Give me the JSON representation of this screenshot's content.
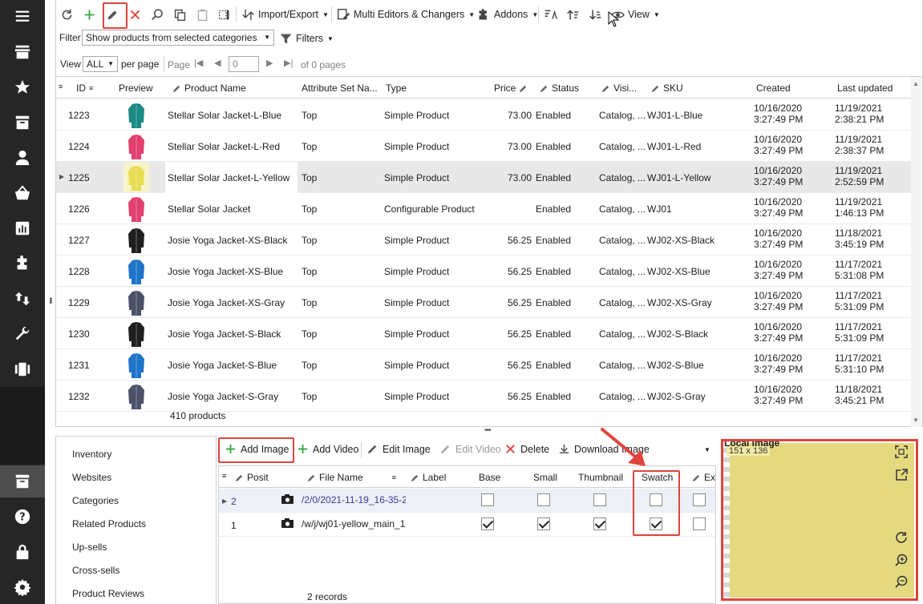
{
  "toolbar": {
    "import_export": "Import/Export",
    "multi_editors": "Multi Editors & Changers",
    "addons": "Addons",
    "view": "View"
  },
  "filter": {
    "label": "Filter",
    "value": "Show products from selected categories",
    "filters_button": "Filters"
  },
  "pager": {
    "view_label": "View",
    "view_value": "ALL",
    "per_page": "per page",
    "page_label": "Page",
    "page_value": "0",
    "of_pages": "of 0 pages"
  },
  "grid": {
    "columns": [
      "ID",
      "Preview",
      "Product Name",
      "Attribute Set Na...",
      "Type",
      "Price",
      "Status",
      "Visi...",
      "SKU",
      "Created",
      "Last updated"
    ],
    "rows": [
      {
        "id": "1223",
        "name": "Stellar Solar Jacket-L-Blue",
        "attr": "Top",
        "type": "Simple Product",
        "price": "73.00",
        "status": "Enabled",
        "vis": "Catalog, ...",
        "sku": "WJ01-L-Blue",
        "created": "10/16/2020 3:27:49 PM",
        "updated": "11/19/2021 2:38:21 PM",
        "color": "teal"
      },
      {
        "id": "1224",
        "name": "Stellar Solar Jacket-L-Red",
        "attr": "Top",
        "type": "Simple Product",
        "price": "73.00",
        "status": "Enabled",
        "vis": "Catalog, ...",
        "sku": "WJ01-L-Red",
        "created": "10/16/2020 3:27:49 PM",
        "updated": "11/19/2021 2:38:37 PM",
        "color": "pink"
      },
      {
        "id": "1225",
        "name": "Stellar Solar Jacket-L-Yellow",
        "attr": "Top",
        "type": "Simple Product",
        "price": "73.00",
        "status": "Enabled",
        "vis": "Catalog, ...",
        "sku": "WJ01-L-Yellow",
        "created": "10/16/2020 3:27:49 PM",
        "updated": "11/19/2021 2:52:59 PM",
        "color": "yellow"
      },
      {
        "id": "1226",
        "name": "Stellar Solar Jacket",
        "attr": "Top",
        "type": "Configurable Product",
        "price": "",
        "status": "Enabled",
        "vis": "Catalog, ...",
        "sku": "WJ01",
        "created": "10/16/2020 3:27:49 PM",
        "updated": "11/19/2021 1:46:13 PM",
        "color": "pink"
      },
      {
        "id": "1227",
        "name": "Josie Yoga Jacket-XS-Black",
        "attr": "Top",
        "type": "Simple Product",
        "price": "56.25",
        "status": "Enabled",
        "vis": "Catalog, ...",
        "sku": "WJ02-XS-Black",
        "created": "10/16/2020 3:27:49 PM",
        "updated": "11/18/2021 3:45:19 PM",
        "color": "black"
      },
      {
        "id": "1228",
        "name": "Josie Yoga Jacket-XS-Blue",
        "attr": "Top",
        "type": "Simple Product",
        "price": "56.25",
        "status": "Enabled",
        "vis": "Catalog, ...",
        "sku": "WJ02-XS-Blue",
        "created": "10/16/2020 3:27:49 PM",
        "updated": "11/17/2021 5:31:08 PM",
        "color": "blue"
      },
      {
        "id": "1229",
        "name": "Josie Yoga Jacket-XS-Gray",
        "attr": "Top",
        "type": "Simple Product",
        "price": "56.25",
        "status": "Enabled",
        "vis": "Catalog, ...",
        "sku": "WJ02-XS-Gray",
        "created": "10/16/2020 3:27:49 PM",
        "updated": "11/17/2021 5:31:09 PM",
        "color": "gray"
      },
      {
        "id": "1230",
        "name": "Josie Yoga Jacket-S-Black",
        "attr": "Top",
        "type": "Simple Product",
        "price": "56.25",
        "status": "Enabled",
        "vis": "Catalog, ...",
        "sku": "WJ02-S-Black",
        "created": "10/16/2020 3:27:49 PM",
        "updated": "11/17/2021 5:31:09 PM",
        "color": "black"
      },
      {
        "id": "1231",
        "name": "Josie Yoga Jacket-S-Blue",
        "attr": "Top",
        "type": "Simple Product",
        "price": "56.25",
        "status": "Enabled",
        "vis": "Catalog, ...",
        "sku": "WJ02-S-Blue",
        "created": "10/16/2020 3:27:49 PM",
        "updated": "11/17/2021 5:31:10 PM",
        "color": "blue"
      },
      {
        "id": "1232",
        "name": "Josie Yoga Jacket-S-Gray",
        "attr": "Top",
        "type": "Simple Product",
        "price": "56.25",
        "status": "Enabled",
        "vis": "Catalog, ...",
        "sku": "WJ02-S-Gray",
        "created": "10/16/2020 3:27:49 PM",
        "updated": "11/18/2021 3:45:21 PM",
        "color": "gray"
      }
    ],
    "footer": "410 products"
  },
  "tabs": [
    "Inventory",
    "Websites",
    "Categories",
    "Related Products",
    "Up-sells",
    "Cross-sells",
    "Product Reviews"
  ],
  "images": {
    "add_image": "Add Image",
    "add_video": "Add Video",
    "edit_image": "Edit Image",
    "edit_video": "Edit Video",
    "delete": "Delete",
    "download": "Download Image",
    "columns": [
      "Posit",
      "File Name",
      "Label",
      "Base",
      "Small",
      "Thumbnail",
      "Swatch",
      "Ex"
    ],
    "rows": [
      {
        "pos": "2",
        "file": "/2/0/2021-11-19_16-35-2",
        "base": false,
        "small": false,
        "thumb": false,
        "swatch": false
      },
      {
        "pos": "1",
        "file": "/w/j/wj01-yellow_main_1",
        "base": true,
        "small": true,
        "thumb": true,
        "swatch": true
      }
    ],
    "footer": "2 records"
  },
  "local_image": {
    "title": "Local Image",
    "dims": "151 x 136"
  },
  "colors": {
    "accent_red": "#e0443c",
    "nav_bg": "#262626",
    "image_bg": "#e4d97e",
    "green": "#3aa845"
  }
}
